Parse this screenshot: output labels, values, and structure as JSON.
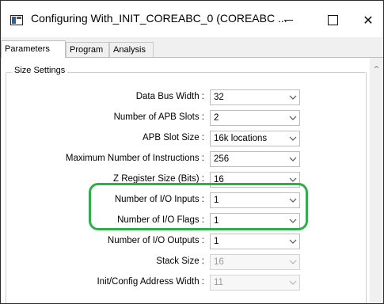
{
  "window": {
    "title": "Configuring With_INIT_COREABC_0 (COREABC ...",
    "minimize_glyph": "—",
    "close_glyph": "✕"
  },
  "tabs": [
    {
      "label": "Parameters",
      "active": true
    },
    {
      "label": "Program",
      "active": false
    },
    {
      "label": "Analysis",
      "active": false
    }
  ],
  "group": {
    "title": "Size Settings"
  },
  "fields": [
    {
      "label": "Data Bus Width :",
      "value": "32",
      "enabled": true
    },
    {
      "label": "Number of APB Slots :",
      "value": "2",
      "enabled": true
    },
    {
      "label": "APB Slot Size :",
      "value": "16k locations",
      "enabled": true
    },
    {
      "label": "Maximum Number of Instructions :",
      "value": "256",
      "enabled": true
    },
    {
      "label": "Z Register Size (Bits) :",
      "value": "16",
      "enabled": true
    },
    {
      "label": "Number of I/O Inputs :",
      "value": "1",
      "enabled": true
    },
    {
      "label": "Number of I/O Flags :",
      "value": "1",
      "enabled": true
    },
    {
      "label": "Number of I/O Outputs :",
      "value": "1",
      "enabled": true
    },
    {
      "label": "Stack Size :",
      "value": "16",
      "enabled": false
    },
    {
      "label": "Init/Config Address Width :",
      "value": "11",
      "enabled": false
    }
  ],
  "annotation": {
    "color": "#2fae4a",
    "highlighted_fields": [
      "Number of I/O Inputs :",
      "Number of I/O Flags :"
    ]
  },
  "scrollbar": {
    "up_glyph": "^"
  },
  "icons": {
    "app": "app-window-icon",
    "minimize": "minimize-icon",
    "maximize": "maximize-icon",
    "close": "close-icon",
    "dropdown": "chevron-down-icon"
  }
}
